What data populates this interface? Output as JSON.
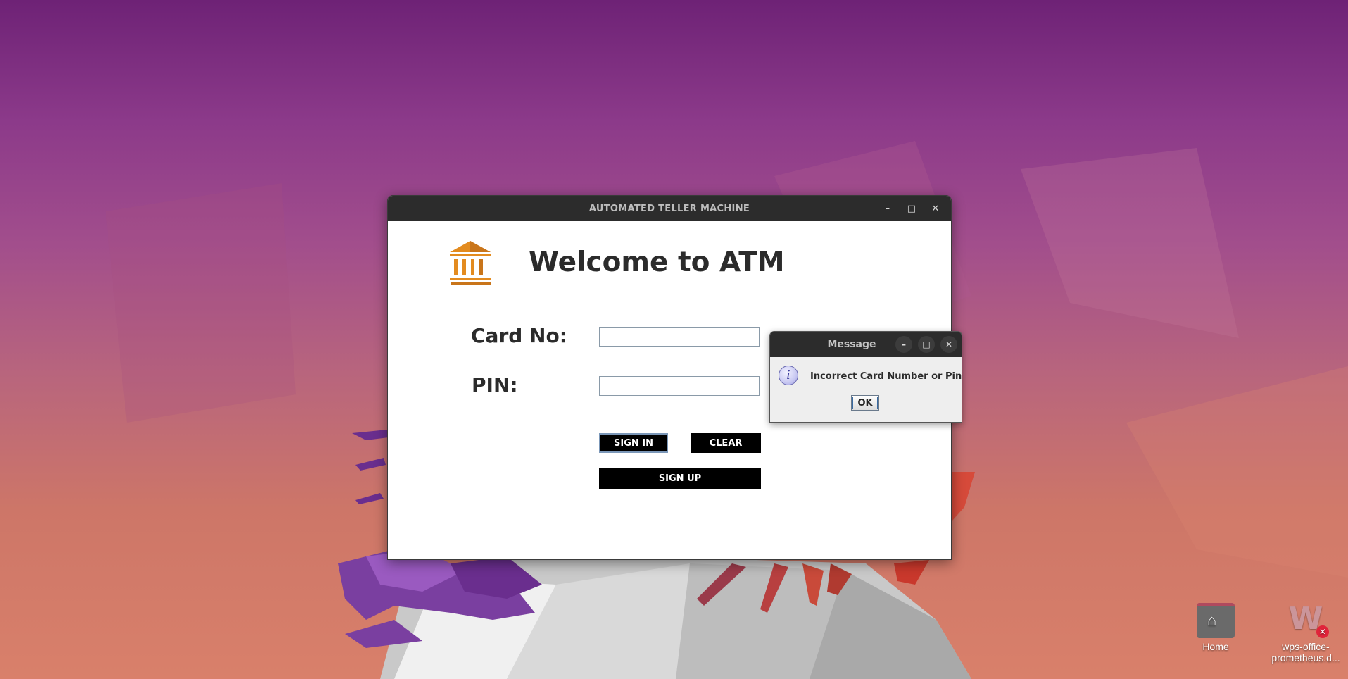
{
  "main_window": {
    "title": "AUTOMATED TELLER MACHINE",
    "controls": {
      "minimize": "–",
      "maximize": "□",
      "close": "✕"
    },
    "logo_icon": "bank-icon",
    "heading": "Welcome to ATM",
    "card_label": "Card No:",
    "card_value": "",
    "pin_label": "PIN:",
    "pin_value": "",
    "signin_label": "SIGN IN",
    "clear_label": "CLEAR",
    "signup_label": "SIGN UP"
  },
  "dialog": {
    "title": "Message",
    "controls": {
      "minimize": "–",
      "maximize": "□",
      "close": "✕"
    },
    "icon": "info-icon",
    "icon_glyph": "i",
    "message": "Incorrect Card Number or Pin",
    "ok_label": "OK"
  },
  "desktop": {
    "icons": [
      {
        "label": "Home",
        "icon": "home-folder-icon"
      },
      {
        "label": "wps-office-prometheus.d...",
        "icon": "wps-office-icon"
      }
    ]
  },
  "colors": {
    "logo_orange": "#e38b1f",
    "titlebar": "#2c2c2c",
    "button_bg": "#000000",
    "badge_red": "#e0243a"
  }
}
